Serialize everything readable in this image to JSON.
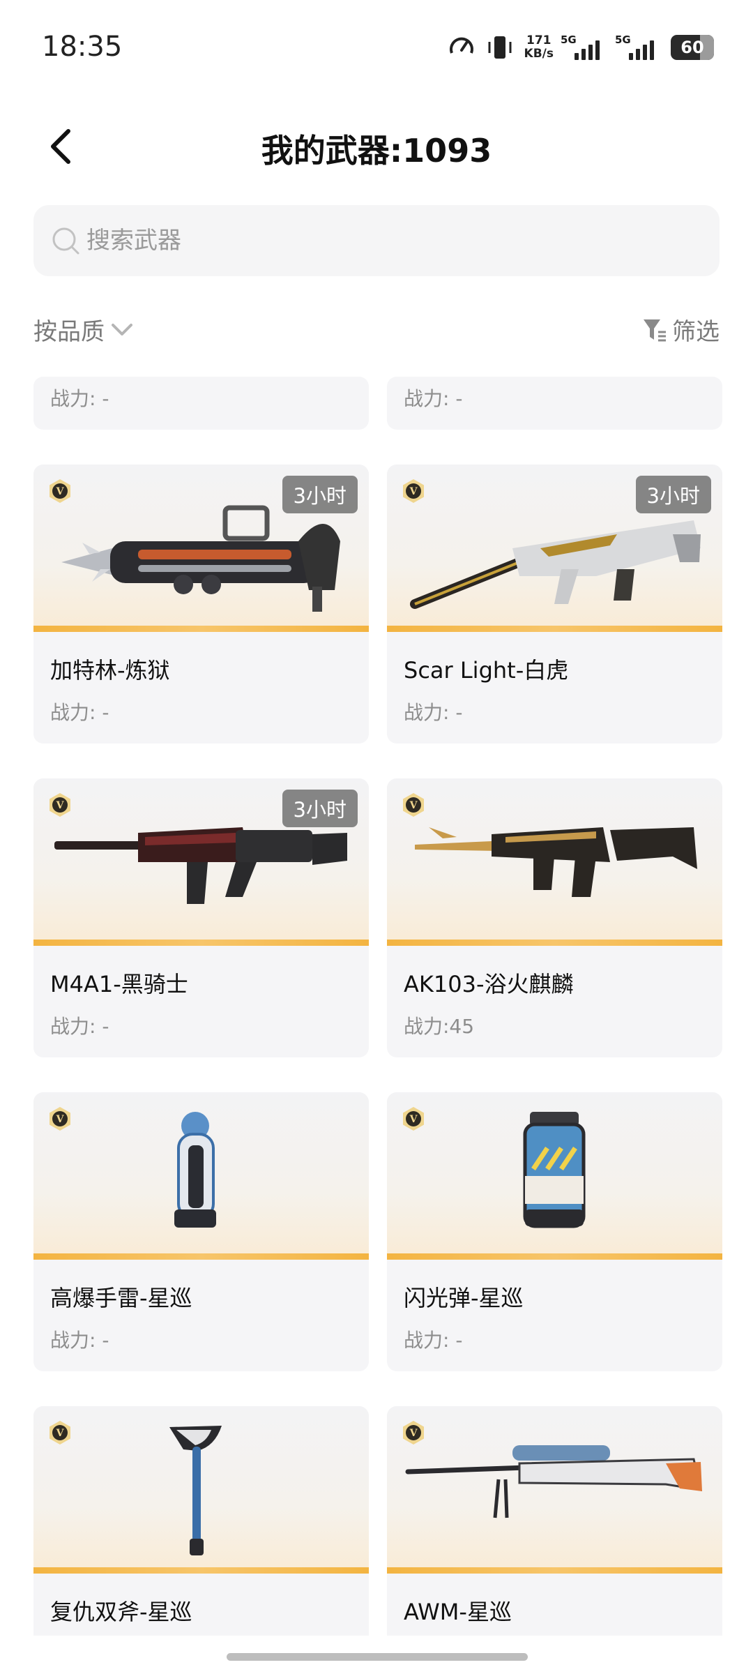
{
  "status_bar": {
    "time": "18:35",
    "speed_value": "171",
    "speed_unit": "KB/s",
    "sim1": "5G",
    "sim2": "5G",
    "battery": "60"
  },
  "header": {
    "title": "我的武器:1093"
  },
  "search": {
    "placeholder": "搜索武器"
  },
  "sort": {
    "label": "按品质"
  },
  "filter": {
    "label": "筛选"
  },
  "partial_row": [
    {
      "power": "战力: -"
    },
    {
      "power": "战力: -"
    }
  ],
  "weapons": [
    {
      "name": "加特林-炼狱",
      "power": "战力: -",
      "tag": "3小时"
    },
    {
      "name": "Scar Light-白虎",
      "power": "战力: -",
      "tag": "3小时"
    },
    {
      "name": "M4A1-黑骑士",
      "power": "战力: -",
      "tag": "3小时"
    },
    {
      "name": "AK103-浴火麒麟",
      "power": "战力:45",
      "tag": ""
    },
    {
      "name": "高爆手雷-星巡",
      "power": "战力: -",
      "tag": ""
    },
    {
      "name": "闪光弹-星巡",
      "power": "战力: -",
      "tag": ""
    },
    {
      "name": "复仇双斧-星巡",
      "power": "",
      "tag": ""
    },
    {
      "name": "AWM-星巡",
      "power": "",
      "tag": ""
    }
  ],
  "colors": {
    "accent_stripe": "#f3b441",
    "card_bg": "#f5f5f7",
    "muted_text": "#8d8d8d"
  }
}
